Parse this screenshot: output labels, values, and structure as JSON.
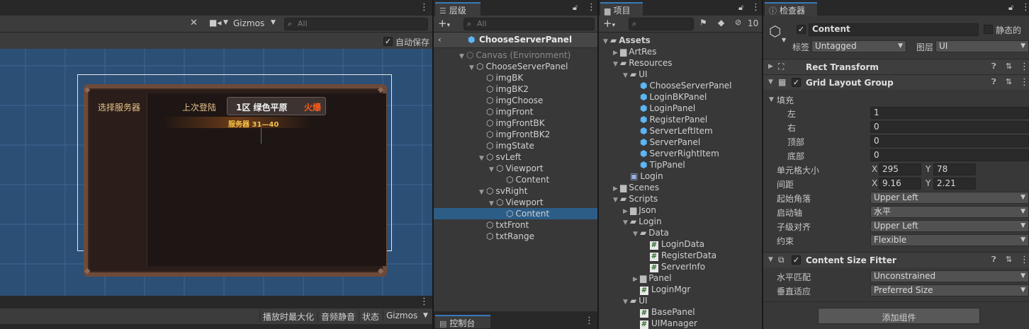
{
  "scene": {
    "gizmos_label": "Gizmos",
    "search_placeholder": "All",
    "autosave_label": "自动保存",
    "autosave_checked": true,
    "game_labels": {
      "select_server": "选择服务器",
      "last_login": "上次登陆",
      "server_name": "1区  绿色平原",
      "server_status": "火爆",
      "server_range": "服务器 31—40"
    },
    "bottom_toolbar": {
      "maximize": "播放时最大化",
      "mute": "音频静音",
      "stats": "状态",
      "gizmos": "Gizmos"
    },
    "colors": {
      "scene_bg": "#2c4f76",
      "grid": "#3f6591"
    }
  },
  "hierarchy": {
    "tab_label": "层级",
    "search_placeholder": "All",
    "prefab_title": "ChooseServerPanel",
    "items": [
      {
        "label": "Canvas (Environment)",
        "depth": 0,
        "expanded": true,
        "dim": true
      },
      {
        "label": "ChooseServerPanel",
        "depth": 1,
        "expanded": true
      },
      {
        "label": "imgBK",
        "depth": 2
      },
      {
        "label": "imgBK2",
        "depth": 2
      },
      {
        "label": "imgChoose",
        "depth": 2
      },
      {
        "label": "imgFront",
        "depth": 2
      },
      {
        "label": "imgFrontBK",
        "depth": 2
      },
      {
        "label": "imgFrontBK2",
        "depth": 2
      },
      {
        "label": "imgState",
        "depth": 2
      },
      {
        "label": "svLeft",
        "depth": 2,
        "expanded": true
      },
      {
        "label": "Viewport",
        "depth": 3,
        "expanded": true
      },
      {
        "label": "Content",
        "depth": 4
      },
      {
        "label": "svRight",
        "depth": 2,
        "expanded": true
      },
      {
        "label": "Viewport",
        "depth": 3,
        "expanded": true
      },
      {
        "label": "Content",
        "depth": 4,
        "selected": true
      },
      {
        "label": "txtFront",
        "depth": 2
      },
      {
        "label": "txtRange",
        "depth": 2
      }
    ]
  },
  "console": {
    "tab_label": "控制台"
  },
  "project": {
    "tab_label": "项目",
    "hidden_count": "10",
    "items": [
      {
        "label": "Assets",
        "depth": 0,
        "type": "folder",
        "expanded": true,
        "bold": true
      },
      {
        "label": "ArtRes",
        "depth": 1,
        "type": "folder",
        "collapsed": true
      },
      {
        "label": "Resources",
        "depth": 1,
        "type": "folder",
        "expanded": true
      },
      {
        "label": "UI",
        "depth": 2,
        "type": "folder",
        "expanded": true
      },
      {
        "label": "ChooseServerPanel",
        "depth": 3,
        "type": "prefab"
      },
      {
        "label": "LoginBKPanel",
        "depth": 3,
        "type": "prefab"
      },
      {
        "label": "LoginPanel",
        "depth": 3,
        "type": "prefab"
      },
      {
        "label": "RegisterPanel",
        "depth": 3,
        "type": "prefab"
      },
      {
        "label": "ServerLeftItem",
        "depth": 3,
        "type": "prefab"
      },
      {
        "label": "ServerPanel",
        "depth": 3,
        "type": "prefab"
      },
      {
        "label": "ServerRightItem",
        "depth": 3,
        "type": "prefab"
      },
      {
        "label": "TipPanel",
        "depth": 3,
        "type": "prefab"
      },
      {
        "label": "Login",
        "depth": 2,
        "type": "scene"
      },
      {
        "label": "Scenes",
        "depth": 1,
        "type": "folder",
        "collapsed": true
      },
      {
        "label": "Scripts",
        "depth": 1,
        "type": "folder",
        "expanded": true
      },
      {
        "label": "Json",
        "depth": 2,
        "type": "folder",
        "collapsed": true
      },
      {
        "label": "Login",
        "depth": 2,
        "type": "folder",
        "expanded": true
      },
      {
        "label": "Data",
        "depth": 3,
        "type": "folder",
        "expanded": true
      },
      {
        "label": "LoginData",
        "depth": 4,
        "type": "script"
      },
      {
        "label": "RegisterData",
        "depth": 4,
        "type": "script"
      },
      {
        "label": "ServerInfo",
        "depth": 4,
        "type": "script"
      },
      {
        "label": "Panel",
        "depth": 3,
        "type": "folder",
        "collapsed": true
      },
      {
        "label": "LoginMgr",
        "depth": 3,
        "type": "script"
      },
      {
        "label": "UI",
        "depth": 2,
        "type": "folder",
        "expanded": true
      },
      {
        "label": "BasePanel",
        "depth": 3,
        "type": "script"
      },
      {
        "label": "UIManager",
        "depth": 3,
        "type": "script"
      }
    ]
  },
  "inspector": {
    "tab_label": "检查器",
    "object_name": "Content",
    "static_label": "静态的",
    "tag_label": "标签",
    "tag_value": "Untagged",
    "layer_label": "图层",
    "layer_value": "UI",
    "rect_transform": "Rect Transform",
    "grid_layout": {
      "title": "Grid Layout Group",
      "padding_label": "填充",
      "left_label": "左",
      "left_value": "1",
      "right_label": "右",
      "right_value": "0",
      "top_label": "顶部",
      "top_value": "0",
      "bottom_label": "底部",
      "bottom_value": "0",
      "cell_size_label": "单元格大小",
      "cell_x": "295",
      "cell_y": "78",
      "spacing_label": "间距",
      "spacing_x": "9.16",
      "spacing_y": "2.21",
      "start_corner_label": "起始角落",
      "start_corner_value": "Upper Left",
      "start_axis_label": "启动轴",
      "start_axis_value": "水平",
      "child_align_label": "子级对齐",
      "child_align_value": "Upper Left",
      "constraint_label": "约束",
      "constraint_value": "Flexible"
    },
    "content_size_fitter": {
      "title": "Content Size Fitter",
      "h_fit_label": "水平匹配",
      "h_fit_value": "Unconstrained",
      "v_fit_label": "垂直适应",
      "v_fit_value": "Preferred Size"
    },
    "add_component": "添加组件"
  }
}
